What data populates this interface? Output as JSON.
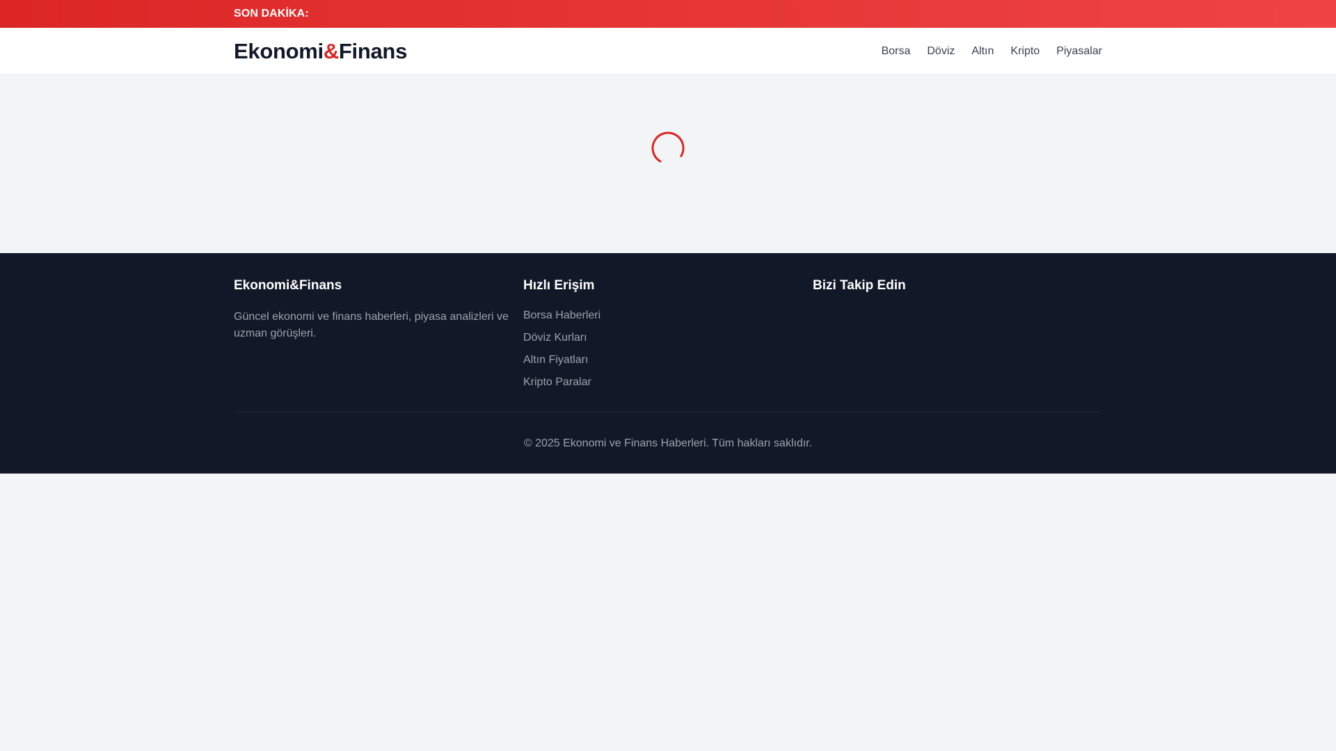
{
  "breaking": {
    "label": "SON DAKİKA:"
  },
  "header": {
    "logo_part1": "Ekonomi",
    "logo_amp": "&",
    "logo_part2": "Finans",
    "nav": [
      "Borsa",
      "Döviz",
      "Altın",
      "Kripto",
      "Piyasalar"
    ]
  },
  "main": {
    "loading_icon": "spinner-icon"
  },
  "footer": {
    "brand_title": "Ekonomi&Finans",
    "brand_desc": "Güncel ekonomi ve finans haberleri, piyasa analizleri ve uzman görüşleri.",
    "quick_title": "Hızlı Erişim",
    "quick_links": [
      "Borsa Haberleri",
      "Döviz Kurları",
      "Altın Fiyatları",
      "Kripto Paralar"
    ],
    "follow_title": "Bizi Takip Edin",
    "copyright": "© 2025 Ekonomi ve Finans Haberleri. Tüm hakları saklıdır."
  },
  "colors": {
    "accent": "#dc2626",
    "footer_bg": "#111827",
    "page_bg": "#f3f4f6"
  }
}
